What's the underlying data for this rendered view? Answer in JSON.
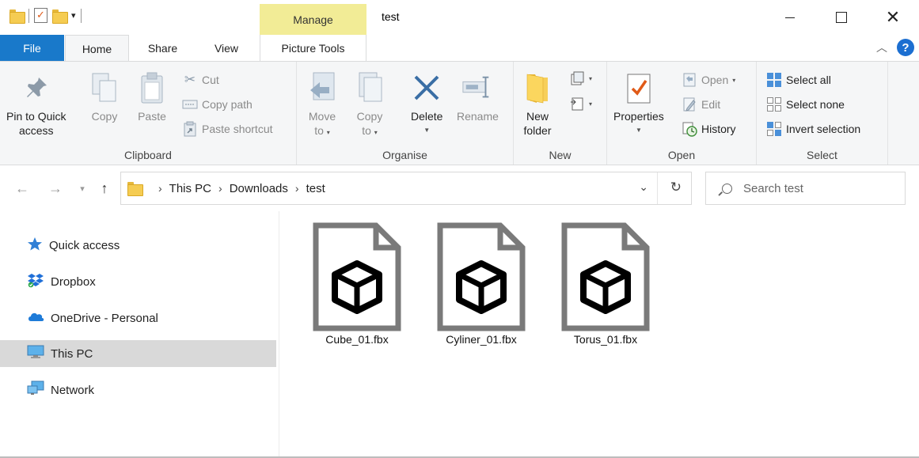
{
  "window": {
    "title": "test",
    "context_tab_group": "Manage"
  },
  "ribbon_tabs": {
    "file": "File",
    "home": "Home",
    "share": "Share",
    "view": "View",
    "picture_tools": "Picture Tools",
    "help": "?"
  },
  "clipboard": {
    "label": "Clipboard",
    "pin_line1": "Pin to Quick",
    "pin_line2": "access",
    "copy": "Copy",
    "paste": "Paste",
    "cut": "Cut",
    "copy_path": "Copy path",
    "paste_shortcut": "Paste shortcut"
  },
  "organise": {
    "label": "Organise",
    "move_to_line1": "Move",
    "move_to_line2": "to",
    "copy_to_line1": "Copy",
    "copy_to_line2": "to",
    "delete": "Delete",
    "rename": "Rename"
  },
  "new_group": {
    "label": "New",
    "new_folder_line1": "New",
    "new_folder_line2": "folder"
  },
  "open_group": {
    "label": "Open",
    "properties": "Properties",
    "open": "Open",
    "edit": "Edit",
    "history": "History"
  },
  "select_group": {
    "label": "Select",
    "select_all": "Select all",
    "select_none": "Select none",
    "invert_selection": "Invert selection"
  },
  "address": {
    "crumbs": [
      "This PC",
      "Downloads",
      "test"
    ],
    "search_placeholder": "Search test"
  },
  "sidebar": {
    "items": [
      {
        "label": "Quick access"
      },
      {
        "label": "Dropbox"
      },
      {
        "label": "OneDrive - Personal"
      },
      {
        "label": "This PC",
        "selected": true
      },
      {
        "label": "Network"
      }
    ]
  },
  "files": [
    {
      "name": "Cube_01.fbx"
    },
    {
      "name": "Cyliner_01.fbx"
    },
    {
      "name": "Torus_01.fbx"
    }
  ],
  "colors": {
    "file_tab": "#1979ca",
    "manage_highlight": "#f2ec96",
    "selected_nav": "#d9d9d9"
  }
}
